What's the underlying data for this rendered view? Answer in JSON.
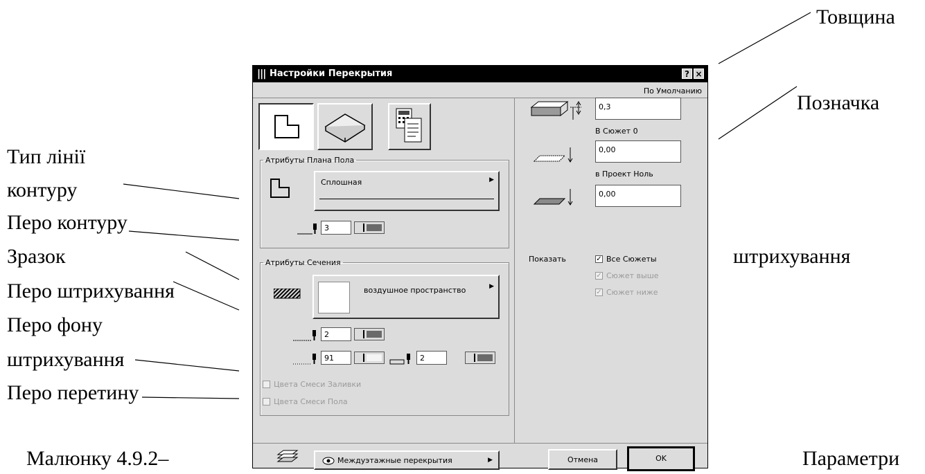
{
  "annotations": {
    "thickness": "Товщина",
    "marking": "Позначка",
    "line_type_1": "Тип лінії",
    "line_type_2": "контуру",
    "contour_pen": "Перо контуру",
    "sample": "Зразок",
    "hatch_pen": "Перо штрихування",
    "bg_pen_1": "Перо фону",
    "bg_pen_2": "штрихування",
    "cut_pen": "Перо перетину",
    "right_hatching": "штрихування",
    "caption_left": "Малюнку 4.9.2–",
    "caption_right": "Параметри"
  },
  "dialog": {
    "title": "Настройки Перекрытия",
    "title_icon": "slab-settings-icon",
    "help_label": "?",
    "close_label": "×",
    "default_label": "По Умолчанию",
    "floor_plan": {
      "legend": "Атрибуты Плана Пола",
      "line_type": "Сплошная",
      "contour_pen": "3"
    },
    "section": {
      "legend": "Атрибуты Сечения",
      "fill_name": "воздушное пространство",
      "hatch_pen": "2",
      "background_pen": "91",
      "cut_pen": "2",
      "fill_blend_label": "Цвета Смеси Заливки",
      "floor_blend_label": "Цвета Смеси Пола"
    },
    "geometry": {
      "thickness": "0,3",
      "to_story_label": "В Сюжет 0",
      "to_story_value": "0,00",
      "to_project_label": "в Проект Ноль",
      "to_project_value": "0,00"
    },
    "show": {
      "label": "Показать",
      "all_stories": "Все Сюжеты",
      "all_stories_checked": true,
      "story_above": "Сюжет выше",
      "story_below": "Сюжет ниже"
    },
    "footer": {
      "category": "Междуэтажные перекрытия",
      "cancel": "Отмена",
      "ok": "OK"
    }
  }
}
